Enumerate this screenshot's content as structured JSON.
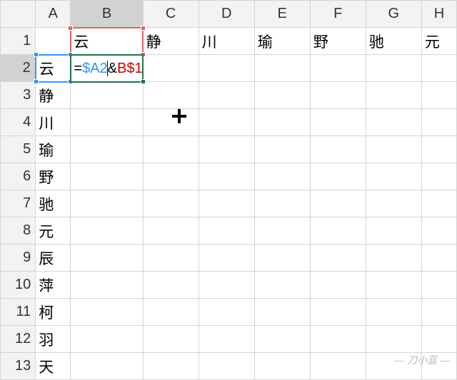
{
  "columns": [
    "A",
    "B",
    "C",
    "D",
    "E",
    "F",
    "G",
    "H"
  ],
  "rows_visible": [
    "1",
    "2",
    "3",
    "4",
    "5",
    "6",
    "7",
    "8",
    "9",
    "10",
    "11",
    "12",
    "13"
  ],
  "selected_cell": "B2",
  "header_row_values": {
    "B": "云",
    "C": "静",
    "D": "川",
    "E": "瑜",
    "F": "野",
    "G": "驰",
    "H": "元"
  },
  "side_col_values": {
    "2": "云",
    "3": "静",
    "4": "川",
    "5": "瑜",
    "6": "野",
    "7": "驰",
    "8": "元",
    "9": "辰",
    "10": "萍",
    "11": "柯",
    "12": "羽",
    "13": "天"
  },
  "formula": {
    "raw": "=$A2&B$1",
    "eq": "=",
    "ref1": "$A2",
    "amp": "&",
    "ref2": "B$1",
    "target_ref_blue": "A2",
    "target_ref_red": "B1"
  },
  "watermark": "— 刀小蓝 —",
  "chart_data": {
    "type": "table",
    "title": "Excel worksheet — formula entry demonstrating mixed references",
    "active_cell": "B2",
    "formula_in_active_cell": "=$A2&B$1",
    "row1_headers": {
      "B": "云",
      "C": "静",
      "D": "川",
      "E": "瑜",
      "F": "野",
      "G": "驰",
      "H": "元"
    },
    "colA_values": {
      "2": "云",
      "3": "静",
      "4": "川",
      "5": "瑜",
      "6": "野",
      "7": "驰",
      "8": "元",
      "9": "辰",
      "10": "萍",
      "11": "柯",
      "12": "羽",
      "13": "天"
    },
    "referenced_cells": {
      "blue": "A2",
      "red": "B1"
    }
  }
}
